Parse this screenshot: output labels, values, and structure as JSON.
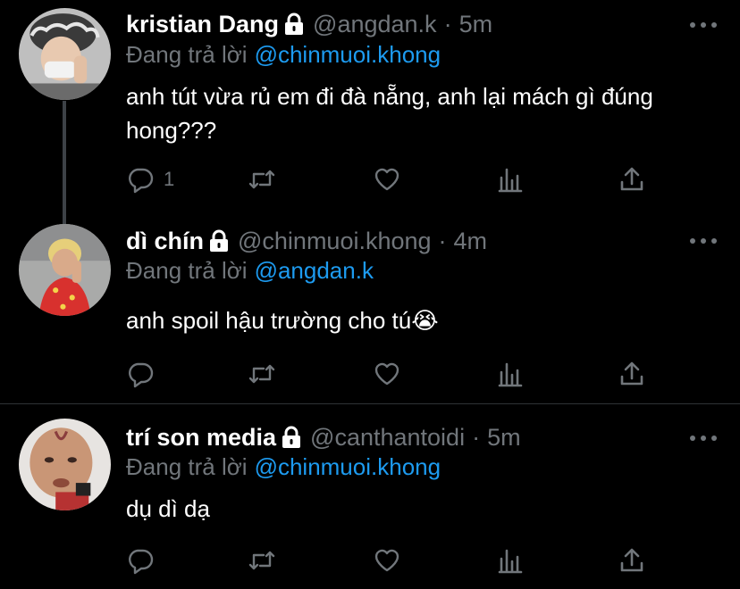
{
  "tweets": [
    {
      "name": "kristian Dang",
      "handle": "@angdan.k",
      "time": "5m",
      "replying_prefix": "Đang trả lời",
      "replying_to": "@chinmuoi.khong",
      "text": "anh tút vừa rủ em đi đà nẵng, anh lại mách gì đúng hong???",
      "reply_count": "1"
    },
    {
      "name": "dì chín",
      "handle": "@chinmuoi.khong",
      "time": "4m",
      "replying_prefix": "Đang trả lời",
      "replying_to": "@angdan.k",
      "text": "anh spoil hậu trường cho tú😭",
      "reply_count": ""
    },
    {
      "name": "trí son media",
      "handle": "@canthantoidi",
      "time": "5m",
      "replying_prefix": "Đang trả lời",
      "replying_to": "@chinmuoi.khong",
      "text": "dụ dì dạ",
      "reply_count": ""
    }
  ],
  "separator": "·",
  "icons": {
    "lock": "lock-icon",
    "more": "more-icon",
    "reply": "reply-icon",
    "retweet": "retweet-icon",
    "like": "heart-icon",
    "analytics": "analytics-icon",
    "share": "share-icon"
  },
  "colors": {
    "background": "#000000",
    "text": "#ffffff",
    "muted": "#71767b",
    "accent": "#1d9bf0",
    "thread_line": "#3d4247"
  }
}
